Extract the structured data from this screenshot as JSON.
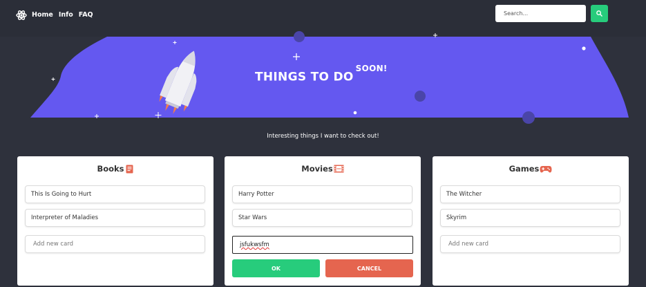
{
  "nav": {
    "links": [
      "Home",
      "Info",
      "FAQ"
    ],
    "search_placeholder": "Search..."
  },
  "hero": {
    "title": "THINGS TO DO",
    "title_sup": "SOON!"
  },
  "subtitle": "Interesting things I want to check out!",
  "cards": [
    {
      "title": "Books",
      "icon": "book-icon",
      "items": [
        "This Is Going to Hurt",
        "Interpreter of Maladies"
      ],
      "add_placeholder": "Add new card"
    },
    {
      "title": "Movies",
      "icon": "film-icon",
      "items": [
        "Harry Potter",
        "Star Wars"
      ],
      "edit_value": "jsfukwsfm",
      "ok_label": "OK",
      "cancel_label": "CANCEL"
    },
    {
      "title": "Games",
      "icon": "gamepad-icon",
      "items": [
        "The Witcher",
        "Skyrim"
      ],
      "add_placeholder": "Add new card"
    }
  ],
  "colors": {
    "background": "#2e313c",
    "hero": "#6458f0",
    "accent_green": "#27cc7c",
    "cancel_red": "#e5654f",
    "icon_red": "#e5654f"
  }
}
